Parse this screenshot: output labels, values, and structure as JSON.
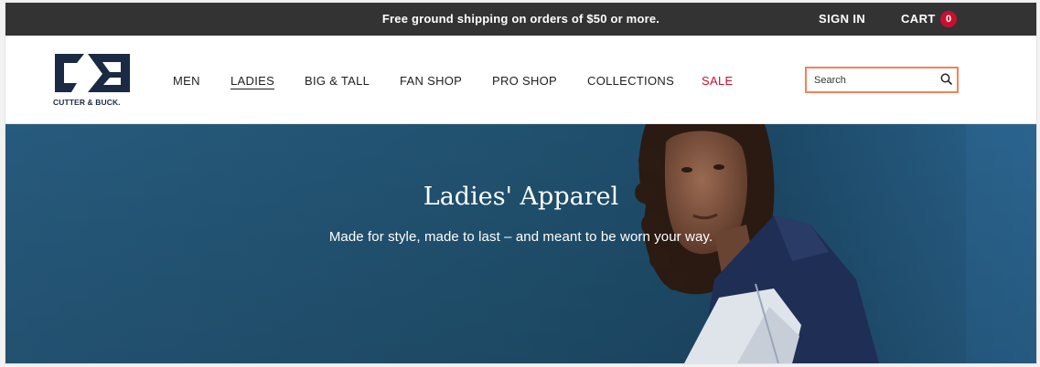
{
  "promo": {
    "text": "Free ground shipping on orders of $50 or more.",
    "sign_in": "SIGN IN",
    "cart_label": "CART",
    "cart_count": "0"
  },
  "brand": {
    "logo_text": "CUTTER & BUCK.",
    "accent_color": "#c8102e",
    "navy_color": "#1b2a44"
  },
  "nav": {
    "items": [
      {
        "label": "MEN"
      },
      {
        "label": "LADIES",
        "active": true
      },
      {
        "label": "BIG & TALL"
      },
      {
        "label": "FAN SHOP"
      },
      {
        "label": "PRO SHOP"
      },
      {
        "label": "COLLECTIONS"
      },
      {
        "label": "SALE"
      }
    ]
  },
  "search": {
    "placeholder": "Search",
    "icon": "search-icon"
  },
  "hero": {
    "title": "Ladies' Apparel",
    "subtitle": "Made for style, made to last – and meant to be worn your way."
  }
}
